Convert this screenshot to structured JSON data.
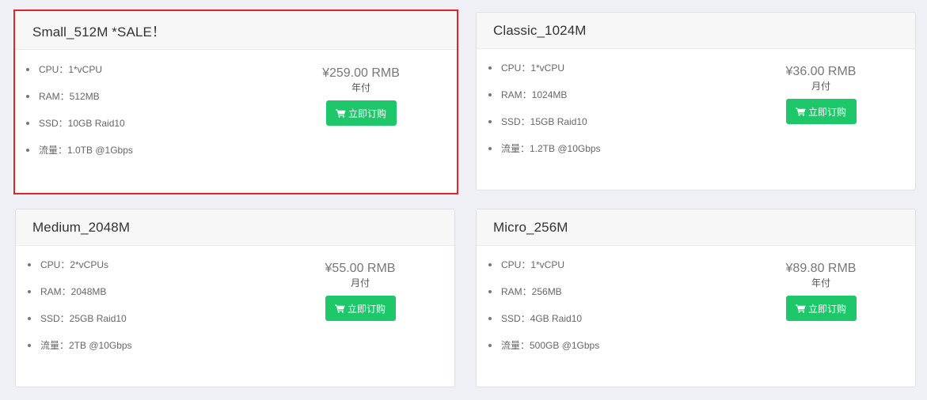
{
  "plans": [
    {
      "title": "Small_512M *SALE！",
      "selected": true,
      "specs": [
        "CPU：1*vCPU",
        "RAM：512MB",
        "SSD：10GB Raid10",
        "流量：1.0TB @1Gbps"
      ],
      "price": "¥259.00 RMB",
      "period": "年付",
      "button_label": "立即订购"
    },
    {
      "title": "Classic_1024M",
      "selected": false,
      "specs": [
        "CPU：1*vCPU",
        "RAM：1024MB",
        "SSD：15GB Raid10",
        "流量：1.2TB @10Gbps"
      ],
      "price": "¥36.00 RMB",
      "period": "月付",
      "button_label": "立即订购"
    },
    {
      "title": "Medium_2048M",
      "selected": false,
      "specs": [
        "CPU：2*vCPUs",
        "RAM：2048MB",
        "SSD：25GB Raid10",
        "流量：2TB @10Gbps"
      ],
      "price": "¥55.00 RMB",
      "period": "月付",
      "button_label": "立即订购"
    },
    {
      "title": "Micro_256M",
      "selected": false,
      "specs": [
        "CPU：1*vCPU",
        "RAM：256MB",
        "SSD：4GB Raid10",
        "流量：500GB @1Gbps"
      ],
      "price": "¥89.80 RMB",
      "period": "年付",
      "button_label": "立即订购"
    }
  ],
  "colors": {
    "button": "#1ec86a",
    "selected_outline": "#e0262b",
    "card_header": "#f7f7f7",
    "page_background": "#eef0f5"
  },
  "icons": {
    "buy_button": "shopping-cart-icon"
  }
}
